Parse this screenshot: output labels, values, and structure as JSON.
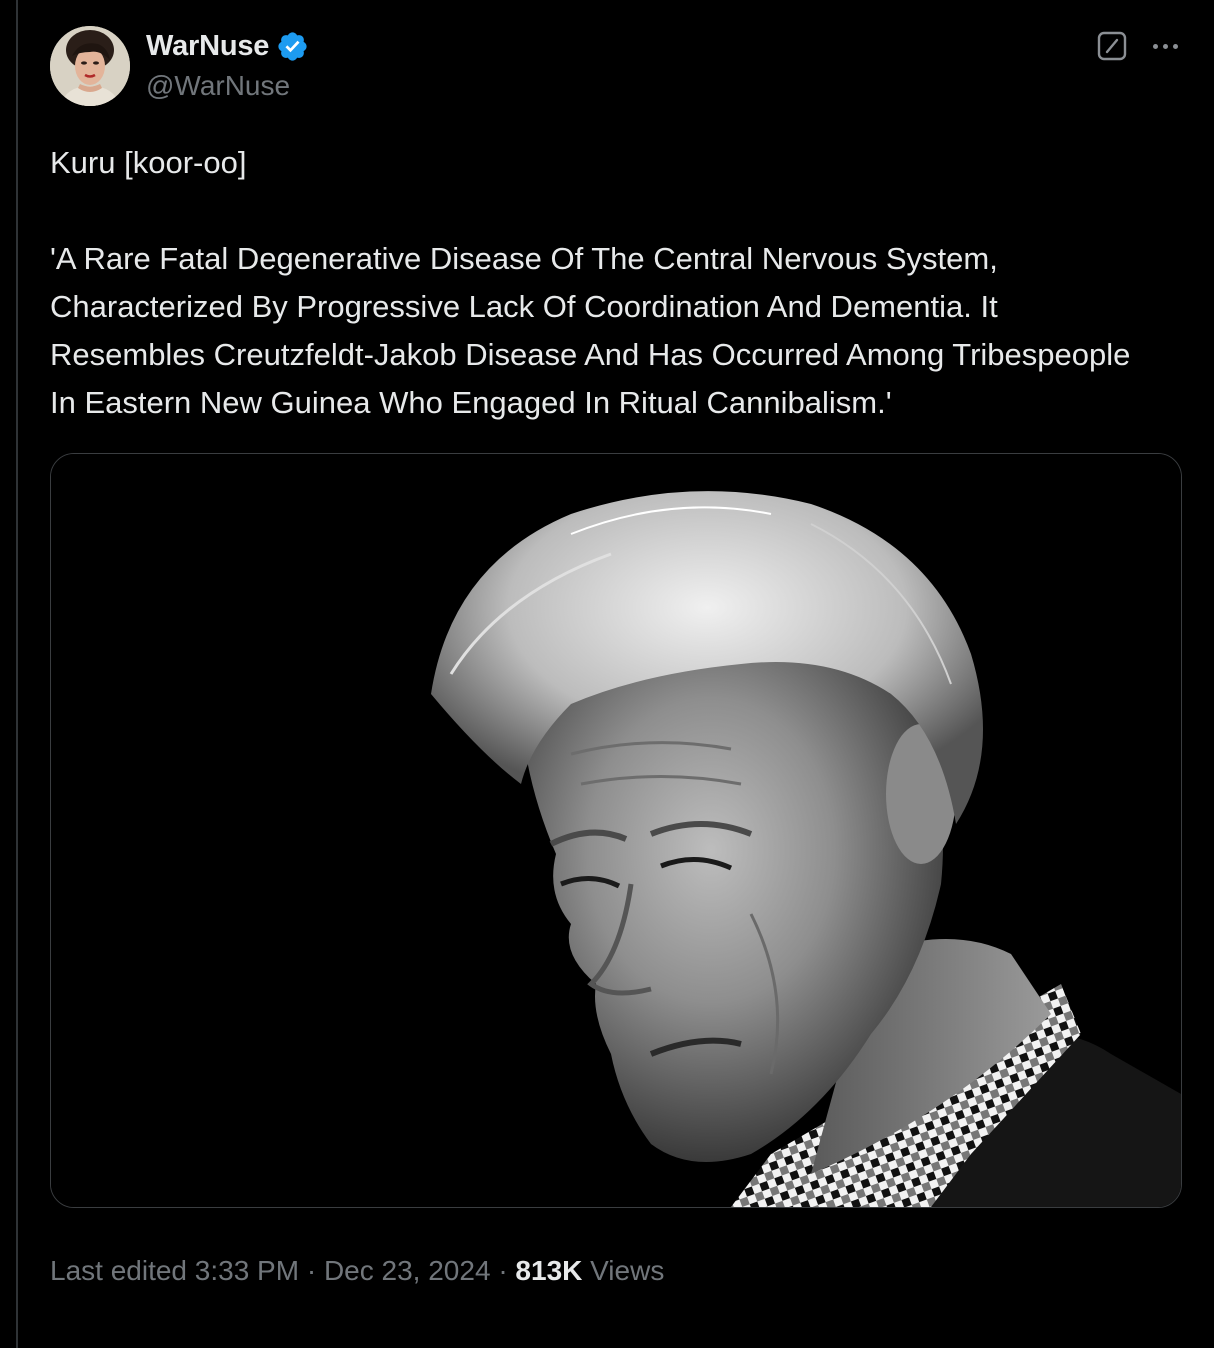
{
  "author": {
    "display_name": "WarNuse",
    "handle": "@WarNuse",
    "verified": true,
    "verified_color": "#1d9bf0"
  },
  "icons": {
    "verified": "verified-badge-icon",
    "grok": "grok-icon",
    "more": "more-options-icon"
  },
  "tweet": {
    "text_lines": [
      "Kuru [koor-oo]",
      "'A Rare Fatal Degenerative Disease Of The Central Nervous System, Characterized By Progressive Lack Of Coordination And Dementia. It Resembles Creutzfeldt-Jakob Disease And Has Occurred Among Tribespeople In Eastern New Guinea Who Engaged In Ritual Cannibalism.'"
    ]
  },
  "meta": {
    "edited_prefix": "Last edited",
    "time": "3:33 PM",
    "separator": "·",
    "date": "Dec 23, 2024",
    "views_count": "813K",
    "views_label": "Views"
  },
  "colors": {
    "background": "#000000",
    "text_primary": "#e7e9ea",
    "text_secondary": "#71767b",
    "border": "#2f3336"
  }
}
